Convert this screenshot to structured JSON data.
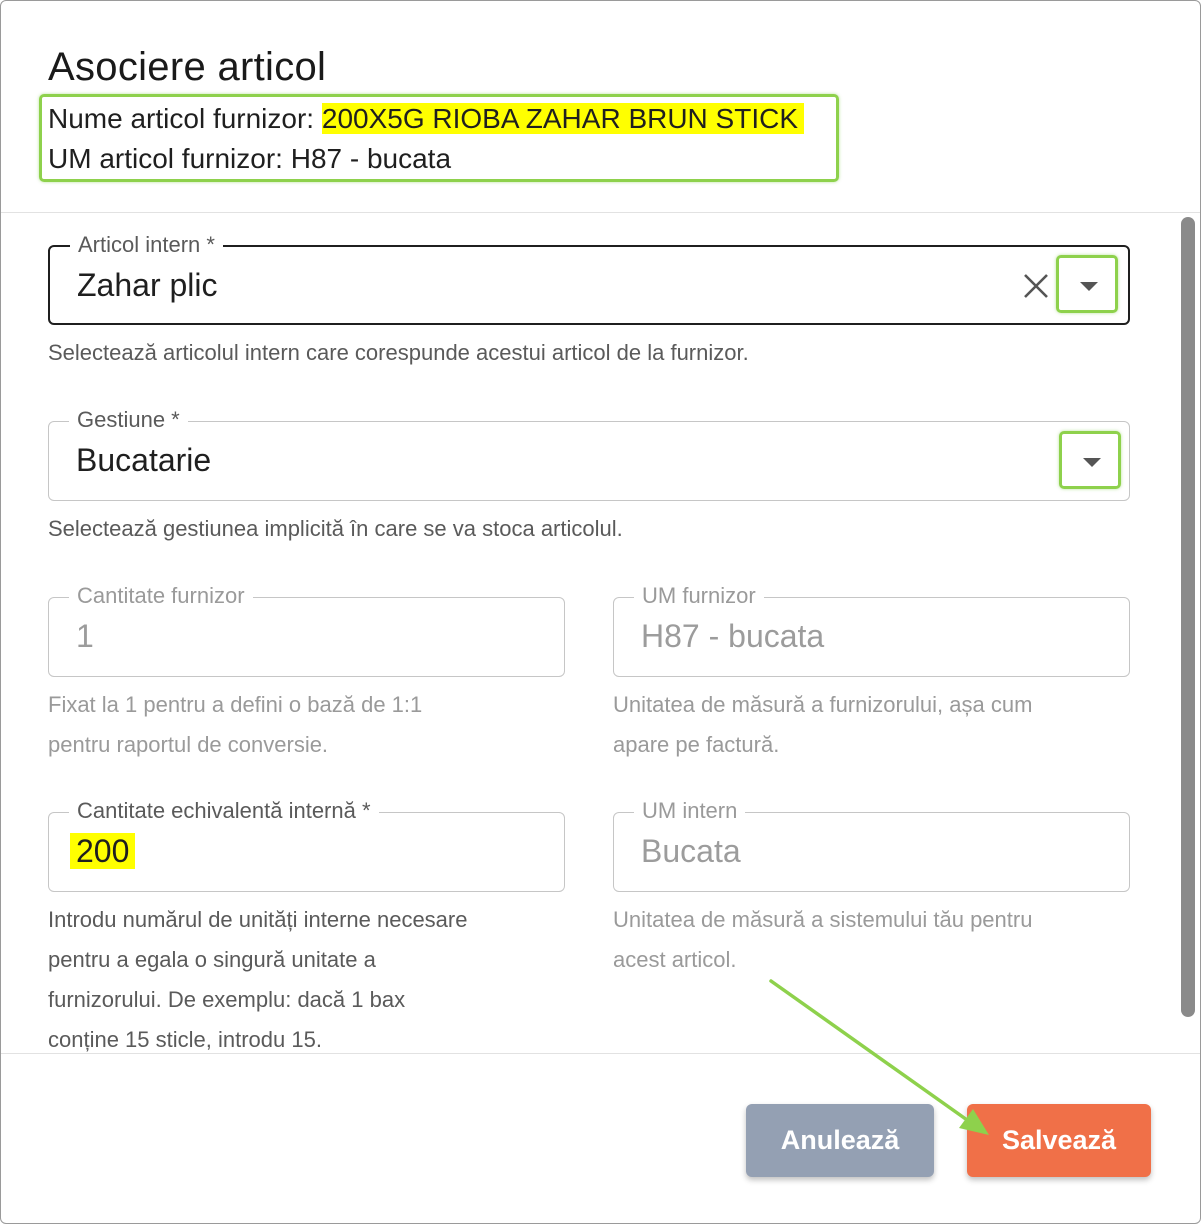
{
  "dialog": {
    "title": "Asociere articol",
    "supplier_name_label": "Nume articol furnizor: ",
    "supplier_name_value": "200X5G RIOBA ZAHAR BRUN STICK",
    "supplier_um_label": "UM articol furnizor: ",
    "supplier_um_value": "H87 - bucata"
  },
  "fields": {
    "internal_item": {
      "label": "Articol intern *",
      "value": "Zahar plic",
      "helper": "Selectează articolul intern care corespunde acestui articol de la furnizor."
    },
    "warehouse": {
      "label": "Gestiune *",
      "value": "Bucatarie",
      "helper": "Selectează gestiunea implicită în care se va stoca articolul."
    },
    "supplier_qty": {
      "label": "Cantitate furnizor",
      "value": "1",
      "helper_1": "Fixat la 1 pentru a defini o bază de 1:1",
      "helper_2": "pentru raportul de conversie."
    },
    "supplier_um": {
      "label": "UM furnizor",
      "value": "H87 - bucata",
      "helper_1": "Unitatea de măsură a furnizorului, așa cum",
      "helper_2": "apare pe factură."
    },
    "internal_qty": {
      "label": "Cantitate echivalentă internă *",
      "value": "200",
      "helper_1": "Introdu numărul de unități interne necesare",
      "helper_2": "pentru a egala o singură unitate a",
      "helper_3": "furnizorului. De exemplu: dacă 1 bax",
      "helper_4": "conține 15 sticle, introdu 15."
    },
    "internal_um": {
      "label": "UM intern",
      "value": "Bucata",
      "helper_1": "Unitatea de măsură a sistemului tău pentru",
      "helper_2": "acest articol."
    }
  },
  "actions": {
    "cancel_label": "Anulează",
    "save_label": "Salvează"
  },
  "colors": {
    "highlight": "#ffff00",
    "annotation_green": "#8ed14c",
    "save_button": "#f07048",
    "cancel_button": "#94a0b3"
  },
  "icons": {
    "clear": "close-icon",
    "dropdown": "caret-down-icon",
    "annotation": "arrow-icon"
  }
}
